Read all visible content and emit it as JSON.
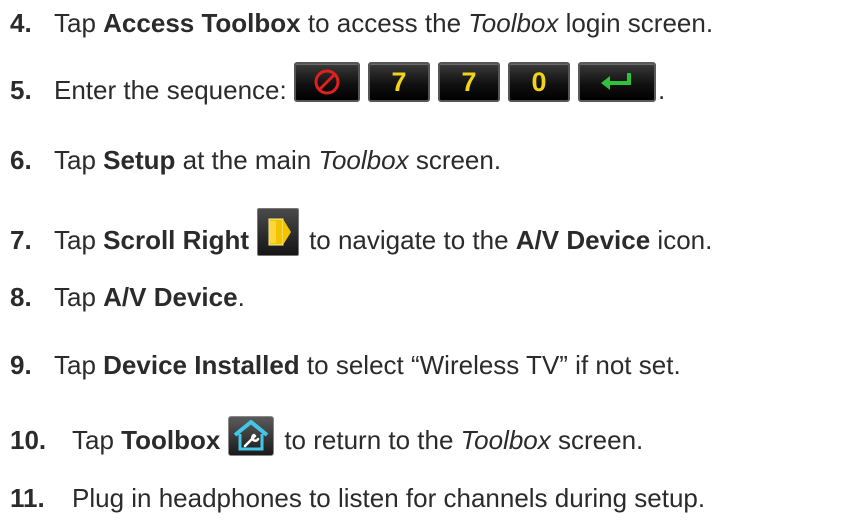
{
  "steps": [
    {
      "number": "4.",
      "pre": "Tap ",
      "bold": "Access Toolbox",
      "mid": " to access the ",
      "italic": "Toolbox",
      "post": " login screen."
    },
    {
      "number": "5.",
      "pre": "Enter the sequence: ",
      "keys": [
        "7",
        "7",
        "0"
      ],
      "post": "."
    },
    {
      "number": "6.",
      "pre": "Tap ",
      "bold": "Setup",
      "mid": " at the main ",
      "italic": "Toolbox",
      "post": " screen."
    },
    {
      "number": "7.",
      "pre": "Tap ",
      "bold": "Scroll Right",
      "mid": "to navigate to the ",
      "bold2": "A/V Device",
      "post": " icon."
    },
    {
      "number": "8.",
      "pre": "Tap ",
      "bold": "A/V Device",
      "post": "."
    },
    {
      "number": "9.",
      "pre": "Tap ",
      "bold": "Device Installed",
      "post": " to select “Wireless TV” if not set."
    },
    {
      "number": "10.",
      "pre": "Tap ",
      "bold": "Toolbox",
      "mid": "to return to the ",
      "italic": "Toolbox",
      "post": " screen."
    },
    {
      "number": "11.",
      "text": "Plug in headphones to listen for channels during setup."
    }
  ],
  "icons": {
    "clear": "clear-key-icon",
    "enter": "enter-key-icon",
    "scroll": "scroll-right-icon",
    "toolbox": "toolbox-home-icon"
  },
  "colors": {
    "key_digit": "#f3d21a",
    "key_clear": "#e0201e",
    "key_enter": "#2fc23a",
    "scroll_arrow": "#f2c400",
    "toolbox_icon": "#43c7e8"
  }
}
